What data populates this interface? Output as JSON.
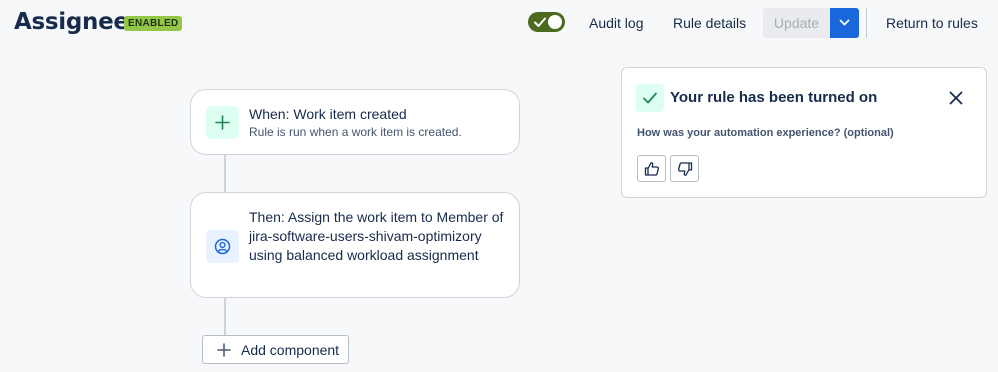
{
  "header": {
    "title": "Assignee",
    "status_badge": "ENABLED",
    "toggle_state": "on",
    "audit_log": "Audit log",
    "rule_details": "Rule details",
    "update": "Update",
    "return_to_rules": "Return to rules"
  },
  "flow": {
    "trigger": {
      "title": "When: Work item created",
      "subtitle": "Rule is run when a work item is created.",
      "icon": "plus-icon"
    },
    "action": {
      "title": "Then: Assign the work item to Member of jira-software-users-shivam-optimizory using balanced workload assignment",
      "icon": "user-circle-icon"
    },
    "add_component": "Add component"
  },
  "flag": {
    "title": "Your rule has been turned on",
    "question": "How was your automation experience? (optional)"
  },
  "colors": {
    "accent_blue": "#1868db",
    "toggle_green": "#4c6b1f",
    "badge_green": "#94c748"
  }
}
